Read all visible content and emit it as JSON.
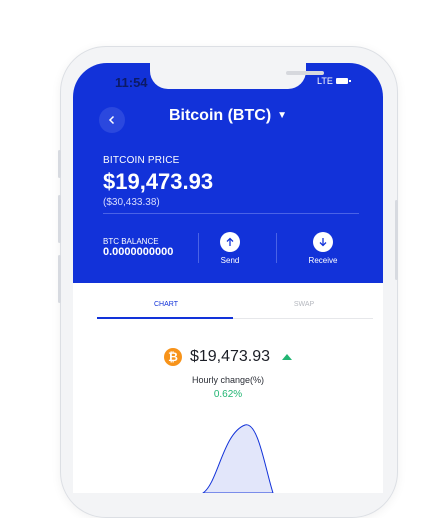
{
  "status_bar": {
    "time": "11:54",
    "network": "LTE"
  },
  "header": {
    "title": "Bitcoin (BTC)",
    "price_label": "BITCOIN PRICE",
    "price": "$19,473.93",
    "price_secondary": "($30,433.38)",
    "balance_label": "BTC BALANCE",
    "balance_value": "0.0000000000",
    "send_label": "Send",
    "receive_label": "Receive"
  },
  "tabs": [
    {
      "label": "CHART",
      "active": true
    },
    {
      "label": "SWAP",
      "active": false
    }
  ],
  "coin": {
    "price": "$19,473.93",
    "hourly_label": "Hourly change(%)",
    "hourly_change": "0.62%"
  },
  "colors": {
    "brand_blue": "#1232d9",
    "btc_orange": "#f7931a",
    "positive_green": "#22b573"
  },
  "icons": [
    "back-icon",
    "dropdown-caret-icon",
    "arrow-up-icon",
    "arrow-down-icon",
    "bitcoin-icon",
    "up-trend-icon"
  ]
}
